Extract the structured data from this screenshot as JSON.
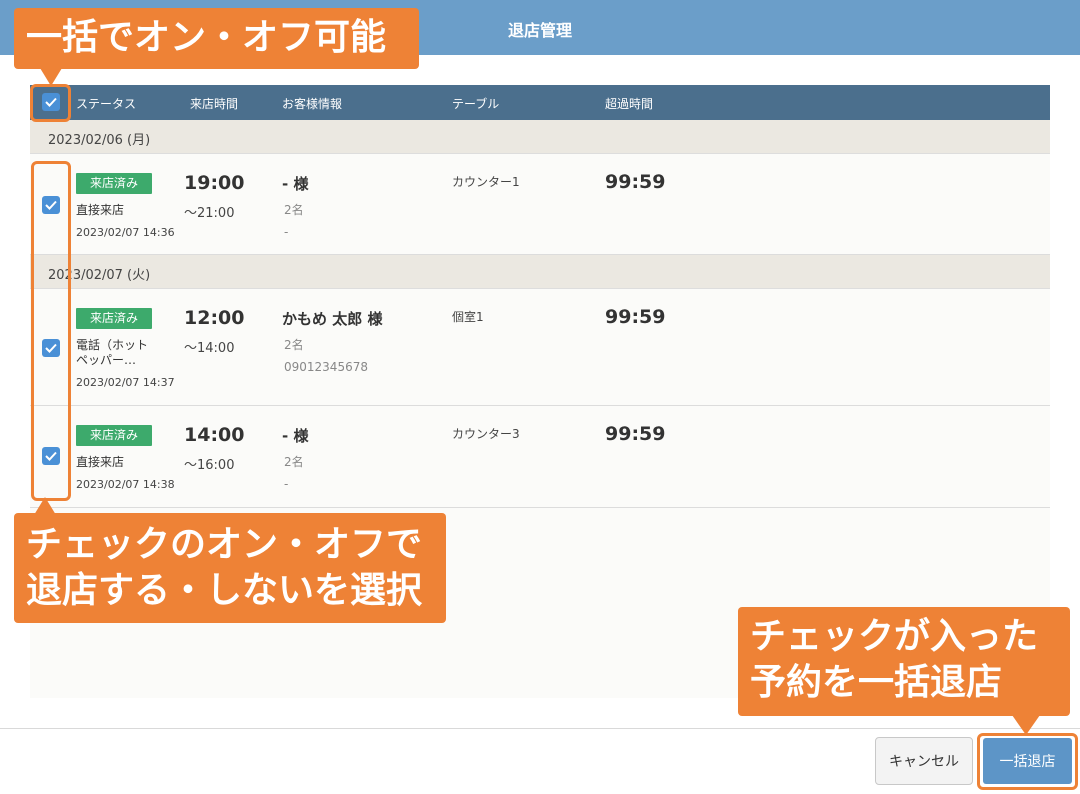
{
  "header": {
    "title": "退店管理"
  },
  "table": {
    "columns": {
      "status": "ステータス",
      "arrival_time": "来店時間",
      "customer_info": "お客様情報",
      "table": "テーブル",
      "overtime": "超過時間"
    },
    "groups": [
      {
        "date": "2023/02/06 (月)",
        "rows": [
          {
            "status": "来店済み",
            "route": "直接来店",
            "timestamp": "2023/02/07 14:36",
            "start": "19:00",
            "end": "〜21:00",
            "guest": "- 様",
            "party": "2名",
            "phone": "-",
            "table": "カウンター1",
            "overtime": "99:59"
          }
        ]
      },
      {
        "date": "2023/02/07 (火)",
        "rows": [
          {
            "status": "来店済み",
            "route": "電話（ホット ペッパー…",
            "timestamp": "2023/02/07 14:37",
            "start": "12:00",
            "end": "〜14:00",
            "guest": "かもめ 太郎 様",
            "party": "2名",
            "phone": "09012345678",
            "table": "個室1",
            "overtime": "99:59"
          },
          {
            "status": "来店済み",
            "route": "直接来店",
            "timestamp": "2023/02/07 14:38",
            "start": "14:00",
            "end": "〜16:00",
            "guest": "- 様",
            "party": "2名",
            "phone": "-",
            "table": "カウンター3",
            "overtime": "99:59"
          }
        ]
      }
    ]
  },
  "footer": {
    "cancel_label": "キャンセル",
    "bulk_checkout_label": "一括退店"
  },
  "annotations": {
    "toggle_all": "一括でオン・オフ可能",
    "row_check_line1": "チェックのオン・オフで",
    "row_check_line2": "退店する・しないを選択",
    "bulk_line1": "チェックが入った",
    "bulk_line2": "予約を一括退店"
  },
  "colors": {
    "header_bar": "#6b9ec9",
    "table_header": "#4b6f8d",
    "status_badge": "#3daa6c",
    "callout": "#ee8236",
    "checkbox": "#4a90d6"
  },
  "icons": {
    "checkbox": "check-icon"
  }
}
